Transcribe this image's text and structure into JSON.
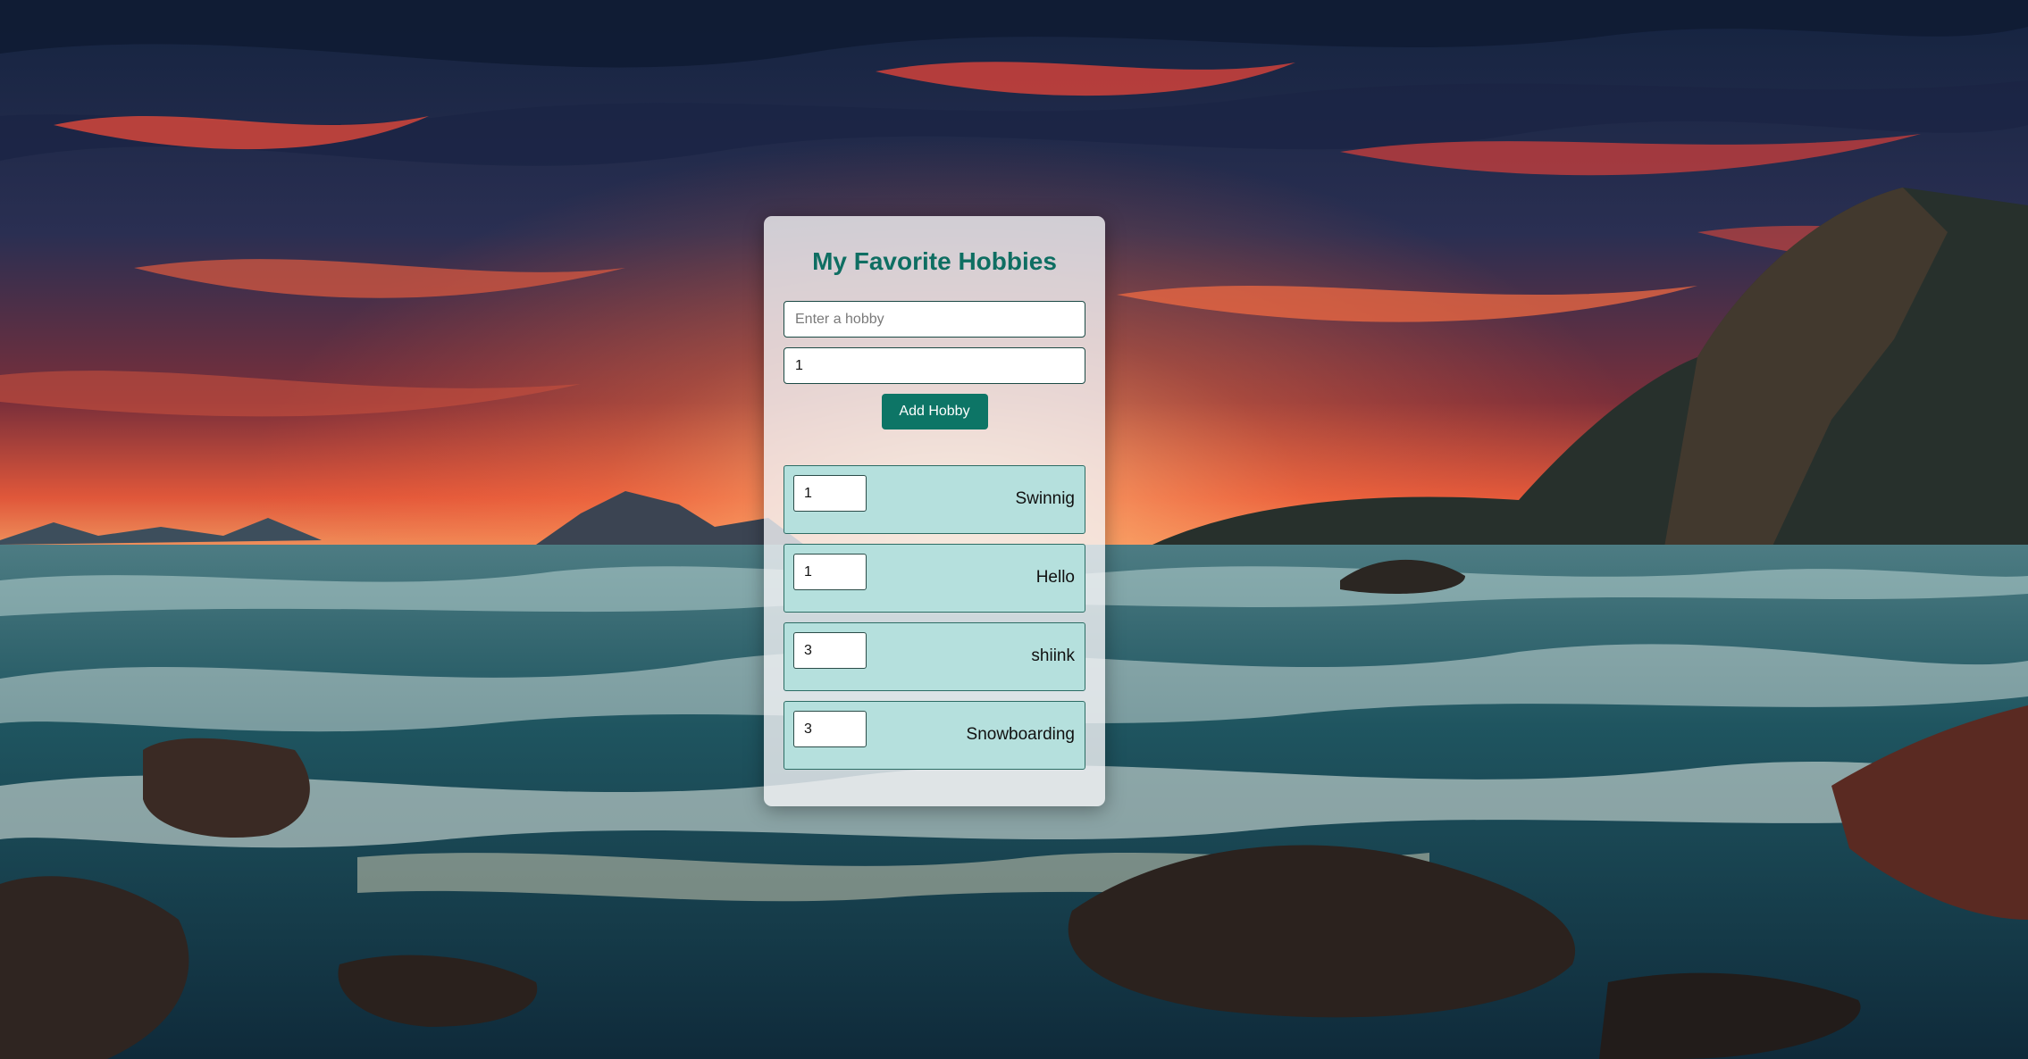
{
  "app": {
    "title": "My Favorite Hobbies"
  },
  "form": {
    "hobby_placeholder": "Enter a hobby",
    "hobby_value": "",
    "priority_value": "1",
    "add_button_label": "Add Hobby"
  },
  "hobbies": [
    {
      "priority": "1",
      "name": "Swinnig"
    },
    {
      "priority": "1",
      "name": "Hello"
    },
    {
      "priority": "3",
      "name": "shiink"
    },
    {
      "priority": "3",
      "name": "Snowboarding"
    }
  ],
  "colors": {
    "accent": "#0d7566",
    "title": "#0e6e62",
    "item_bg": "#b5e0dd",
    "item_border": "#2c6c64"
  }
}
